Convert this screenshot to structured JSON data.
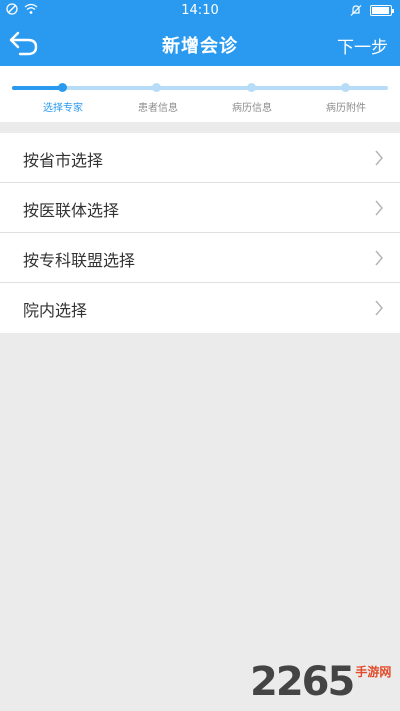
{
  "status_bar": {
    "time": "14:10"
  },
  "header": {
    "title": "新增会诊",
    "next_label": "下一步"
  },
  "steps": [
    {
      "label": "选择专家",
      "active": true
    },
    {
      "label": "患者信息",
      "active": false
    },
    {
      "label": "病历信息",
      "active": false
    },
    {
      "label": "病历附件",
      "active": false
    }
  ],
  "options": [
    {
      "label": "按省市选择"
    },
    {
      "label": "按医联体选择"
    },
    {
      "label": "按专科联盟选择"
    },
    {
      "label": "院内选择"
    }
  ],
  "watermark": {
    "brand": "2265",
    "site": "手游网"
  },
  "colors": {
    "primary": "#2a9af0",
    "track": "#b7dcf8",
    "background": "#ebebeb"
  }
}
